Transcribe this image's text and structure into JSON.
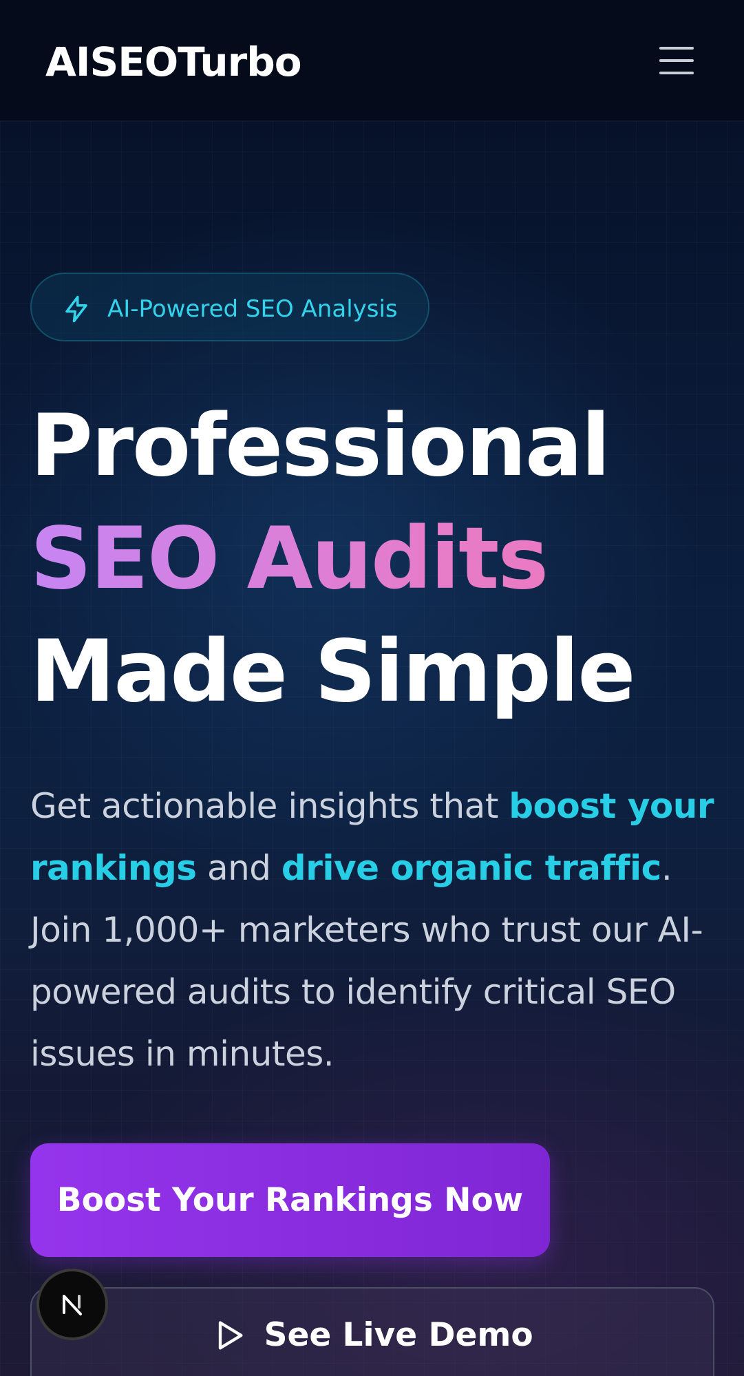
{
  "header": {
    "brand": "AISEOTurbo",
    "menu_icon": "hamburger-menu-icon"
  },
  "hero": {
    "badge": {
      "icon": "lightning-bolt-icon",
      "label": "AI-Powered SEO Analysis"
    },
    "headline": {
      "line1": "Professional",
      "line2": "SEO Audits",
      "line3": "Made Simple"
    },
    "description": {
      "part1": "Get actionable insights that ",
      "highlight1": "boost your rankings",
      "part2": " and ",
      "highlight2": "drive organic traffic",
      "part3": ". Join 1,000+ marketers who trust our AI-powered audits to identify critical SEO issues in minutes."
    },
    "primary_cta": "Boost Your Rankings Now",
    "secondary_cta": {
      "icon": "play-icon",
      "label": "See Live Demo"
    }
  },
  "dev_indicator": {
    "icon": "nextjs-logo-icon",
    "letter": "N"
  },
  "colors": {
    "accent_cyan": "#28cde6",
    "gradient_start": "#c685f3",
    "gradient_end": "#ef75b8",
    "cta_purple": "#9534ec",
    "background": "#050a18"
  }
}
